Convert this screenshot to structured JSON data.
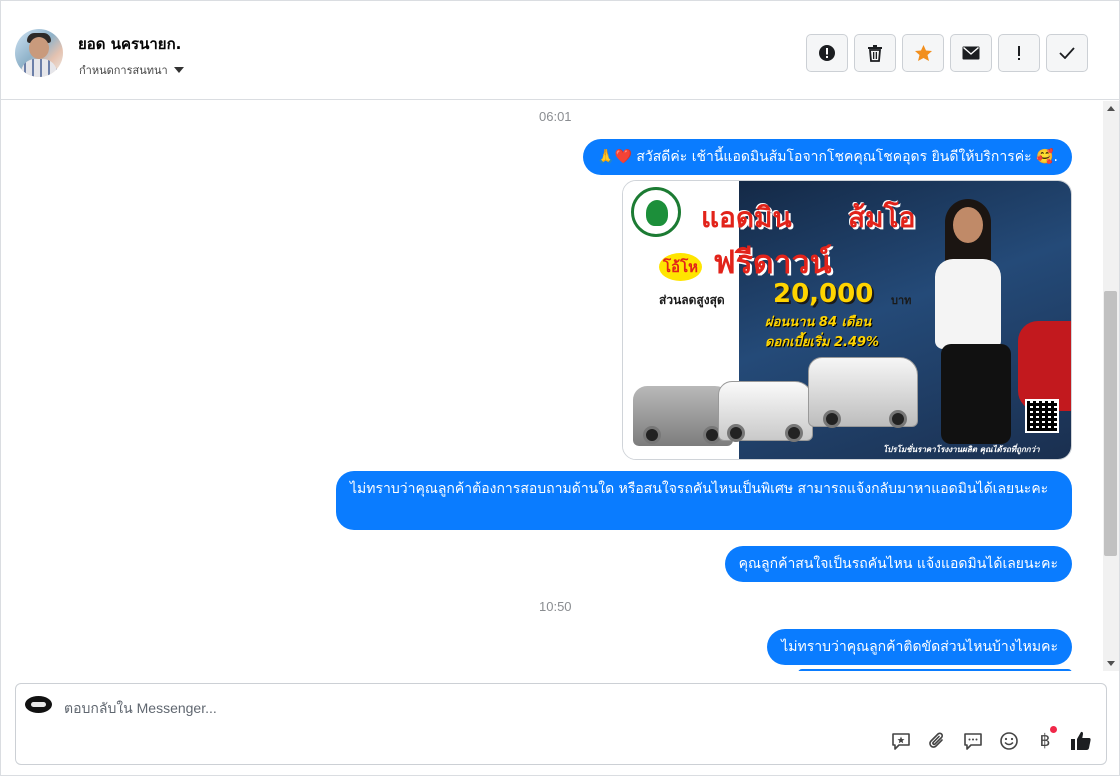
{
  "header": {
    "contact_name": "ยอด นครนายก.",
    "assign_label": "กำหนดการสนทนา",
    "actions": [
      {
        "icon": "alert-circle-icon"
      },
      {
        "icon": "trash-icon"
      },
      {
        "icon": "star-icon",
        "color": "#f28f1d"
      },
      {
        "icon": "envelope-icon"
      },
      {
        "icon": "exclamation-icon"
      },
      {
        "icon": "checkmark-icon"
      }
    ]
  },
  "conversation": {
    "timestamps": [
      "06:01",
      "10:50"
    ],
    "messages": [
      {
        "text": "🙏❤️ สวัสดีค่ะ เช้านี้แอดมินส้มโอจากโชคคุณโชคอุดร ยินดีให้บริการค่ะ 🥰."
      },
      {
        "text": "ไม่ทราบว่าคุณลูกค้าต้องการสอบถามด้านใด หรือสนใจรถคันไหนเป็นพิเศษ สามารถแจ้งกลับมาหาแอดมินได้เลยนะคะ"
      },
      {
        "text": "คุณลูกค้าสนใจเป็นรถคันไหน แจ้งแอดมินได้เลยนะคะ"
      },
      {
        "text": "ไม่ทราบว่าคุณลูกค้าติดขัดส่วนไหนบ้างไหมคะ"
      }
    ],
    "promo_image": {
      "headline_left": "แอดมิน",
      "headline_right": "ส้มโอ",
      "badge": "โอ้โห",
      "main": "ฟรีดาวน์",
      "discount_label": "ส่วนลดสูงสุด",
      "discount_amount": "20,000",
      "discount_unit": "บาท",
      "installment": "ผ่อนนาน 84 เดือน",
      "interest": "ดอกเบี้ยเริ่ม 2.49%",
      "footer": "โปรโมชั่นราคาโรงงานผลิต คุณได้รถที่ถูกกว่า"
    }
  },
  "composer": {
    "placeholder": "ตอบกลับใน Messenger...",
    "tools": [
      "saved-reply-icon",
      "attachment-icon",
      "message-icon",
      "emoji-icon",
      "baht-payment-icon",
      "like-icon"
    ],
    "baht_symbol": "฿"
  },
  "colors": {
    "bubble": "#0a7cff",
    "accent_star": "#f28f1d",
    "notification_dot": "#f02849"
  }
}
